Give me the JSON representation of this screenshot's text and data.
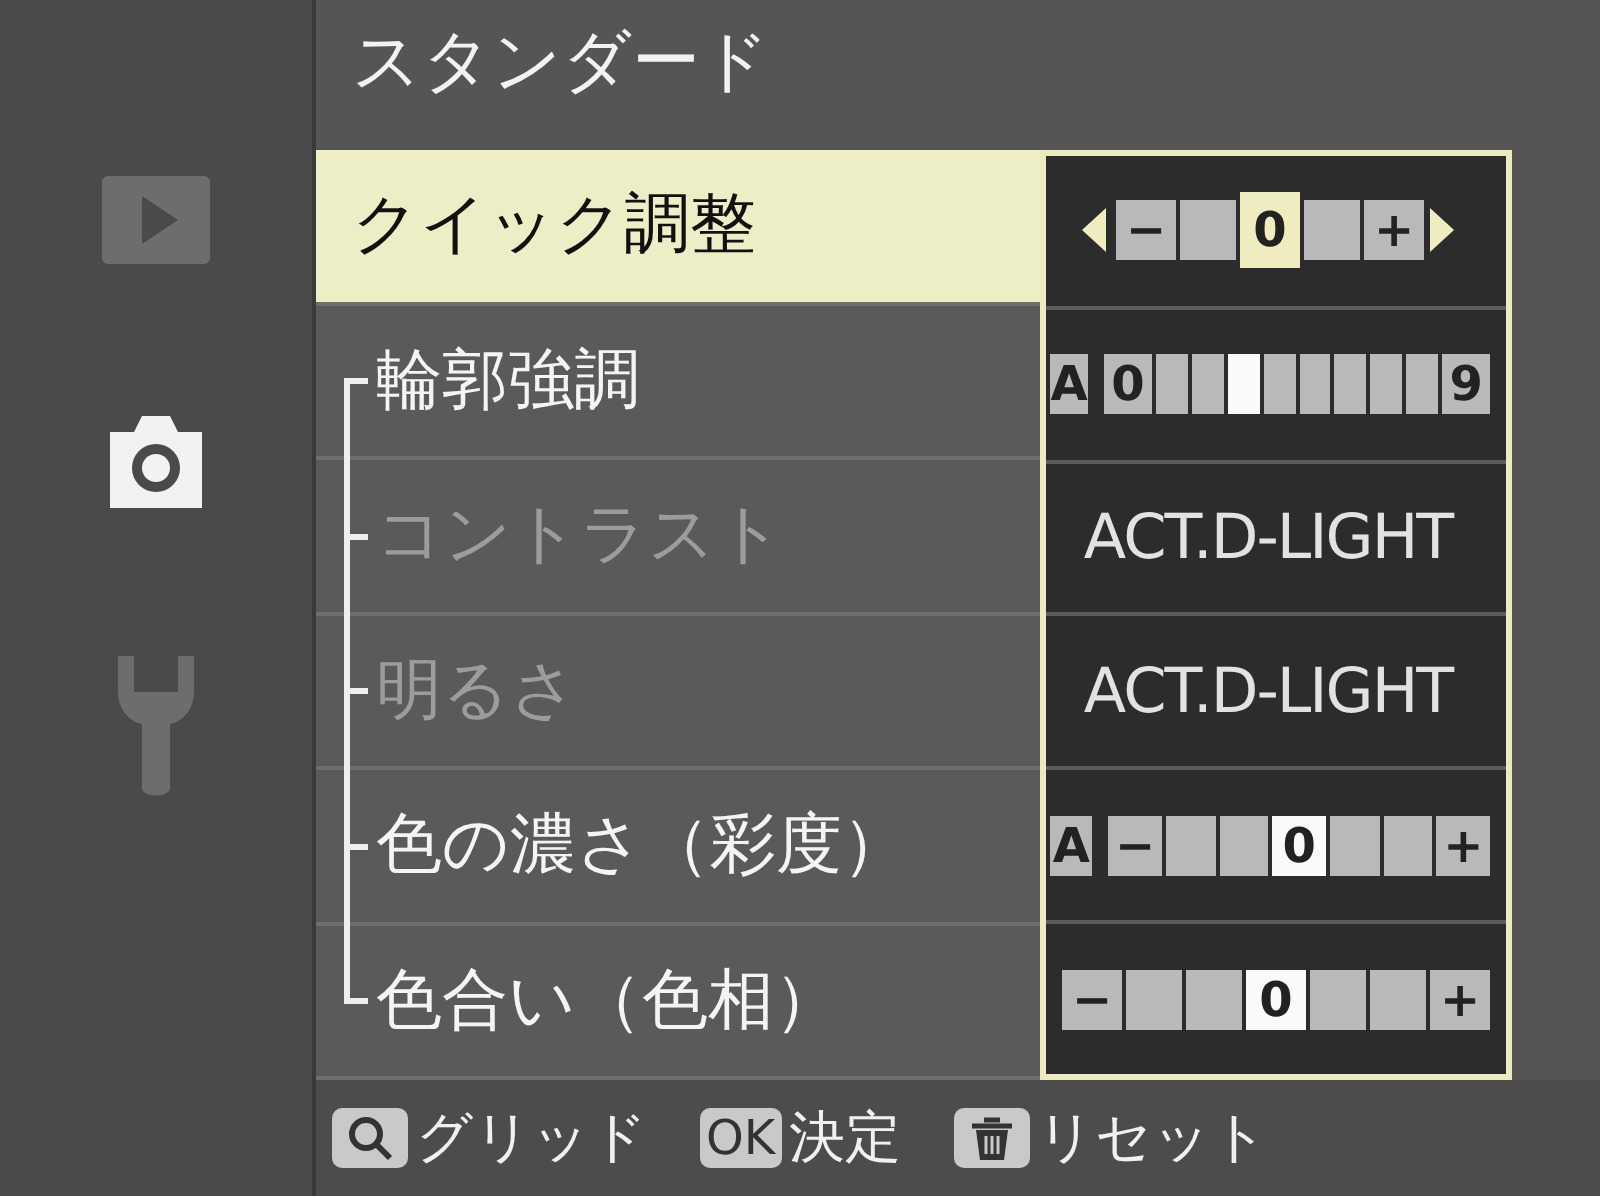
{
  "sidebar": {
    "items": [
      {
        "kind": "play",
        "selected": false
      },
      {
        "kind": "camera",
        "selected": true
      },
      {
        "kind": "wrench",
        "selected": false
      }
    ]
  },
  "title": "スタンダード",
  "rows": [
    {
      "label": "クイック調整",
      "selected": true,
      "disabled": false,
      "value": {
        "kind": "quick",
        "cells": [
          {
            "label": "−",
            "selected": false
          },
          {
            "selected": false
          },
          {
            "label": "0",
            "selected": true
          },
          {
            "selected": false
          },
          {
            "label": "+",
            "selected": false
          }
        ]
      }
    }
  ],
  "detail_rows": [
    {
      "label": "輪郭強調",
      "selected": false,
      "disabled": false,
      "value": {
        "kind": "scale",
        "auto": "A",
        "cells": [
          {
            "label": "0",
            "selected": false
          },
          {
            "selected": false
          },
          {
            "selected": false
          },
          {
            "selected": true
          },
          {
            "selected": false
          },
          {
            "selected": false
          },
          {
            "selected": false
          },
          {
            "selected": false
          },
          {
            "selected": false
          },
          {
            "label": "9",
            "selected": false
          }
        ]
      }
    },
    {
      "label": "コントラスト",
      "selected": false,
      "disabled": true,
      "value": {
        "kind": "text",
        "text": "ACT.D-LIGHT"
      }
    },
    {
      "label": "明るさ",
      "selected": false,
      "disabled": true,
      "value": {
        "kind": "text",
        "text": "ACT.D-LIGHT"
      }
    },
    {
      "label": "色の濃さ（彩度）",
      "selected": false,
      "disabled": false,
      "value": {
        "kind": "scale",
        "auto": "A",
        "cells": [
          {
            "label": "−",
            "selected": false
          },
          {
            "selected": false
          },
          {
            "selected": false
          },
          {
            "label": "0",
            "selected": true
          },
          {
            "selected": false
          },
          {
            "selected": false
          },
          {
            "label": "+",
            "selected": false
          }
        ]
      }
    },
    {
      "label": "色合い（色相）",
      "selected": false,
      "disabled": false,
      "value": {
        "kind": "scale",
        "cells": [
          {
            "label": "−",
            "selected": false
          },
          {
            "selected": false
          },
          {
            "selected": false
          },
          {
            "label": "0",
            "selected": true
          },
          {
            "selected": false
          },
          {
            "selected": false
          },
          {
            "label": "+",
            "selected": false
          }
        ]
      }
    }
  ],
  "footer": [
    {
      "kind": "zoom",
      "label": "グリッド"
    },
    {
      "kind": "key",
      "key": "OK",
      "label": "決定"
    },
    {
      "kind": "trash",
      "label": "リセット"
    }
  ]
}
